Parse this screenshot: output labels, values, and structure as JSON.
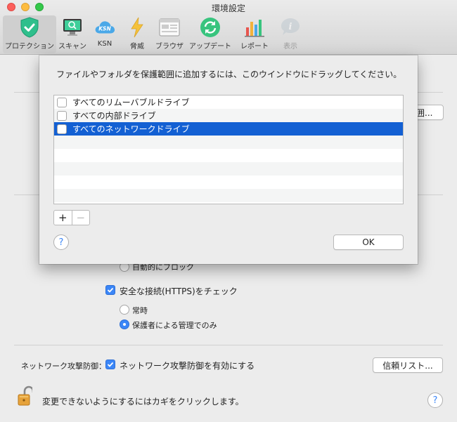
{
  "window": {
    "title": "環境設定"
  },
  "toolbar": {
    "items": [
      {
        "label": "プロテクション",
        "icon": "shield-icon"
      },
      {
        "label": "スキャン",
        "icon": "monitor-scan-icon"
      },
      {
        "label": "KSN",
        "icon": "cloud-ksn-icon"
      },
      {
        "label": "脅威",
        "icon": "lightning-icon"
      },
      {
        "label": "ブラウザ",
        "icon": "browser-icon"
      },
      {
        "label": "アップデート",
        "icon": "refresh-icon"
      },
      {
        "label": "レポート",
        "icon": "bar-chart-icon"
      },
      {
        "label": "表示",
        "icon": "info-icon"
      }
    ]
  },
  "sheet": {
    "message": "ファイルやフォルダを保護範囲に追加するには、このウインドウにドラッグしてください。",
    "list_items": [
      {
        "label": "すべてのリムーバブルドライブ"
      },
      {
        "label": "すべての内部ドライブ"
      },
      {
        "label": "すべてのネットワークドライブ"
      }
    ],
    "add_label": "+",
    "remove_label": "−",
    "help_label": "?",
    "ok_label": "OK"
  },
  "background": {
    "range_button_partial": "囲...",
    "partial_radio_label": "自動的にブロック",
    "https_check_label": "安全な接続(HTTPS)をチェック",
    "radio_always": "常時",
    "radio_parental": "保護者による管理でのみ",
    "network_attack_label": "ネットワーク攻撃防御：",
    "network_attack_check_label": "ネットワーク攻撃防御を有効にする",
    "trust_list_button": "信頼リスト...",
    "lock_message": "変更できないようにするにはカギをクリックします。",
    "help_label": "?"
  },
  "colors": {
    "accent": "#3b86f7",
    "selection": "#1360d3"
  }
}
